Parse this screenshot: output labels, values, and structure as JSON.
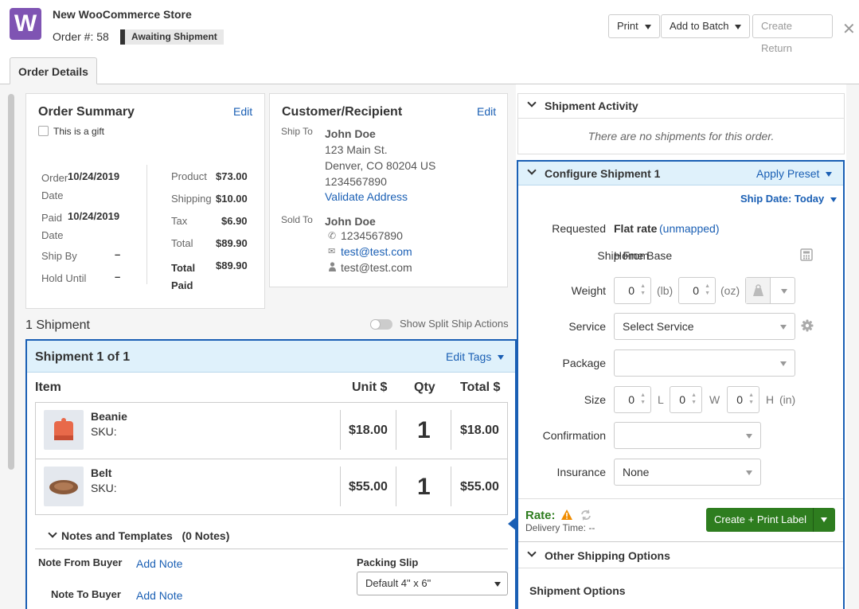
{
  "header": {
    "logo_letter": "W",
    "store_name": "New WooCommerce Store",
    "order_label": "Order #:",
    "order_number": "58",
    "status": "Awaiting Shipment",
    "print_label": "Print",
    "add_batch_label": "Add to Batch",
    "create_return_label": "Create Return",
    "close_glyph": "✕"
  },
  "tabs": [
    {
      "label": "Order Details"
    }
  ],
  "order_summary": {
    "title": "Order Summary",
    "edit": "Edit",
    "gift_label": "This is a gift",
    "order_date_label": "Order Date",
    "order_date": "10/24/2019",
    "paid_date_label": "Paid Date",
    "paid_date": "10/24/2019",
    "ship_by_label": "Ship By",
    "ship_by": "–",
    "hold_until_label": "Hold Until",
    "hold_until": "–",
    "product_label": "Product",
    "product": "$73.00",
    "shipping_label": "Shipping",
    "shipping": "$10.00",
    "tax_label": "Tax",
    "tax": "$6.90",
    "total_label": "Total",
    "total": "$89.90",
    "total_paid_label": "Total Paid",
    "total_paid": "$89.90"
  },
  "customer": {
    "title": "Customer/Recipient",
    "edit": "Edit",
    "ship_to_label": "Ship To",
    "ship_name": "John Doe",
    "ship_addr1": "123 Main St.",
    "ship_addr2": "Denver, CO 80204 US",
    "ship_phone": "1234567890",
    "validate": "Validate Address",
    "sold_to_label": "Sold To",
    "sold_name": "John Doe",
    "sold_phone": "1234567890",
    "sold_email": "test@test.com",
    "sold_user": "test@test.com"
  },
  "shipments": {
    "count_label": "1 Shipment",
    "split_label": "Show Split Ship Actions",
    "title": "Shipment 1 of 1",
    "edit_tags": "Edit Tags",
    "col_item": "Item",
    "col_unit": "Unit $",
    "col_qty": "Qty",
    "col_total": "Total $",
    "items": [
      {
        "name": "Beanie",
        "sku": "SKU:",
        "unit": "$18.00",
        "qty": "1",
        "total": "$18.00"
      },
      {
        "name": "Belt",
        "sku": "SKU:",
        "unit": "$55.00",
        "qty": "1",
        "total": "$55.00"
      }
    ],
    "notes_title": "Notes and Templates",
    "notes_count": "(0 Notes)",
    "note_from_buyer": "Note From Buyer",
    "note_to_buyer": "Note To Buyer",
    "add_note": "Add Note",
    "packing_slip_label": "Packing Slip",
    "packing_slip_value": "Default 4\" x 6\""
  },
  "shipment_activity": {
    "title": "Shipment Activity",
    "empty": "There are no shipments for this order."
  },
  "configure": {
    "title": "Configure Shipment 1",
    "apply_preset": "Apply Preset",
    "ship_date_label": "Ship Date:",
    "ship_date": "Today",
    "requested_label": "Requested",
    "requested_value": "Flat rate",
    "requested_unmapped": "(unmapped)",
    "ship_from_label": "Ship From",
    "ship_from_value": "Home Base",
    "weight_label": "Weight",
    "weight_lb": "0",
    "lb_unit": "(lb)",
    "weight_oz": "0",
    "oz_unit": "(oz)",
    "service_label": "Service",
    "service_value": "Select Service",
    "package_label": "Package",
    "package_value": "",
    "size_label": "Size",
    "size_l": "0",
    "size_w": "0",
    "size_h": "0",
    "l_unit": "L",
    "w_unit": "W",
    "h_unit": "H",
    "in_unit": "(in)",
    "confirmation_label": "Confirmation",
    "confirmation_value": "",
    "insurance_label": "Insurance",
    "insurance_value": "None",
    "rate_label": "Rate:",
    "delivery_label": "Delivery Time: --",
    "create_label": "Create + Print Label",
    "other_options": "Other Shipping Options",
    "shipment_options": "Shipment Options"
  },
  "colors": {
    "accent": "#1a5fb4",
    "highlight": "#dff1fb",
    "brand": "#7f54b3",
    "green": "#2e7d1f",
    "warning": "#f08c00"
  }
}
